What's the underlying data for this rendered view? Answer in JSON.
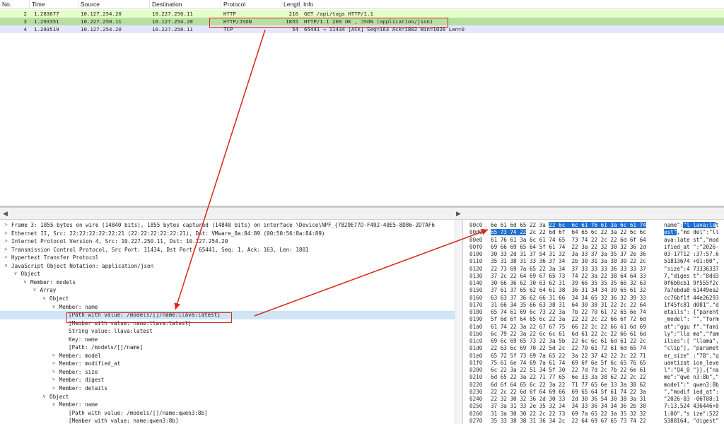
{
  "columns": [
    "No.",
    "Time",
    "Source",
    "Destination",
    "Protocol",
    "Lengtl",
    "Info"
  ],
  "packets": [
    {
      "no": "2",
      "time": "1.283677",
      "src": "10.127.254.20",
      "dst": "10.227.250.11",
      "proto": "HTTP",
      "len": "216",
      "info": "GET /api/tags HTTP/1.1"
    },
    {
      "no": "3",
      "time": "1.293351",
      "src": "10.227.250.11",
      "dst": "10.127.254.20",
      "proto": "HTTP/JSON",
      "len": "1855",
      "info": "HTTP/1.1 200 OK , JSON (application/json)"
    },
    {
      "no": "4",
      "time": "1.293519",
      "src": "10.127.254.20",
      "dst": "10.227.250.11",
      "proto": "TCP",
      "len": "54",
      "info": "65441 → 11434 [ACK] Seq=163 Ack=1802 Win=1026 Len=0"
    }
  ],
  "colors": {
    "row_http": "#e4ffc7",
    "row_selected": "#b7dfa1",
    "row_tcp": "#e7e6ff",
    "tree_selected": "#cfe4f7",
    "hex_highlight": "#1e6fd0",
    "annotation_red": "#d9261c"
  },
  "icons": {
    "expanded": "chevron-down-icon",
    "collapsed": "chevron-right-icon"
  },
  "tree": [
    {
      "level": 0,
      "arrow": ">",
      "text": "Frame 3: 1855 bytes on wire (14840 bits), 1855 bytes captured (14840 bits) on interface \\Device\\NPF_{7829E77D-F492-40E5-8D86-2D7AF6"
    },
    {
      "level": 0,
      "arrow": ">",
      "text": "Ethernet II, Src: 22:22:22:22:22:21 (22:22:22:22:22:21), Dst: VMware_8a:84:89 (00:50:56:8a:84:89)"
    },
    {
      "level": 0,
      "arrow": ">",
      "text": "Internet Protocol Version 4, Src: 10.227.250.11, Dst: 10.127.254.20"
    },
    {
      "level": 0,
      "arrow": ">",
      "text": "Transmission Control Protocol, Src Port: 11434, Dst Port: 65441, Seq: 1, Ack: 163, Len: 1801"
    },
    {
      "level": 0,
      "arrow": ">",
      "text": "Hypertext Transfer Protocol"
    },
    {
      "level": 0,
      "arrow": "v",
      "text": "JavaScript Object Notation: application/json"
    },
    {
      "level": 1,
      "arrow": "v",
      "text": "Object"
    },
    {
      "level": 2,
      "arrow": "v",
      "text": "Member: models"
    },
    {
      "level": 3,
      "arrow": "v",
      "text": "Array"
    },
    {
      "level": 4,
      "arrow": "v",
      "text": "Object"
    },
    {
      "level": 5,
      "arrow": "v",
      "text": "Member: name"
    },
    {
      "level": 6,
      "arrow": "",
      "text": "[Path with value: /models/[]/name:llava:latest]",
      "selected": true
    },
    {
      "level": 6,
      "arrow": "",
      "text": "[Member with value: name:llava:latest]"
    },
    {
      "level": 6,
      "arrow": "",
      "text": "String value: llava:latest"
    },
    {
      "level": 6,
      "arrow": "",
      "text": "Key: name"
    },
    {
      "level": 6,
      "arrow": "",
      "text": "[Path: /models/[]/name]"
    },
    {
      "level": 5,
      "arrow": ">",
      "text": "Member: model"
    },
    {
      "level": 5,
      "arrow": ">",
      "text": "Member: modified_at"
    },
    {
      "level": 5,
      "arrow": ">",
      "text": "Member: size"
    },
    {
      "level": 5,
      "arrow": ">",
      "text": "Member: digest"
    },
    {
      "level": 5,
      "arrow": ">",
      "text": "Member: details"
    },
    {
      "level": 4,
      "arrow": "v",
      "text": "Object"
    },
    {
      "level": 5,
      "arrow": "v",
      "text": "Member: name"
    },
    {
      "level": 6,
      "arrow": "",
      "text": "[Path with value: /models/[]/name:qwen3:8b]"
    },
    {
      "level": 6,
      "arrow": "",
      "text": "[Member with value: name:qwen3:8b]"
    }
  ],
  "hex": [
    {
      "off": "00c0",
      "bytes": [
        "6e",
        "61",
        "6d",
        "65",
        "22",
        "3a",
        "22",
        "6c",
        "6c",
        "61",
        "76",
        "61",
        "3a",
        "6c",
        "61",
        "74"
      ],
      "ascii": "name\":\"l lava:lat",
      "hl_bytes": [
        6,
        15
      ],
      "hl_ascii": [
        6,
        16
      ]
    },
    {
      "off": "00d0",
      "bytes": [
        "65",
        "73",
        "74",
        "22",
        "2c",
        "22",
        "6d",
        "6f",
        "64",
        "65",
        "6c",
        "22",
        "3a",
        "22",
        "6c",
        "6c"
      ],
      "ascii": "est\",\"mo del\":\"ll",
      "hl_bytes": [
        0,
        3
      ],
      "hl_ascii": [
        0,
        4
      ]
    },
    {
      "off": "00e0",
      "bytes": [
        "61",
        "76",
        "61",
        "3a",
        "6c",
        "61",
        "74",
        "65",
        "73",
        "74",
        "22",
        "2c",
        "22",
        "6d",
        "6f",
        "64"
      ],
      "ascii": "ava:late st\",\"mod"
    },
    {
      "off": "00f0",
      "bytes": [
        "69",
        "66",
        "69",
        "65",
        "64",
        "5f",
        "61",
        "74",
        "22",
        "3a",
        "22",
        "32",
        "30",
        "32",
        "36",
        "2d"
      ],
      "ascii": "ified_at \":\"2026-"
    },
    {
      "off": "0100",
      "bytes": [
        "30",
        "33",
        "2d",
        "31",
        "37",
        "54",
        "31",
        "32",
        "3a",
        "33",
        "37",
        "3a",
        "35",
        "37",
        "2e",
        "36"
      ],
      "ascii": "03-17T12 :37:57.6"
    },
    {
      "off": "0110",
      "bytes": [
        "35",
        "31",
        "38",
        "31",
        "33",
        "36",
        "37",
        "34",
        "2b",
        "30",
        "31",
        "3a",
        "30",
        "30",
        "22",
        "2c"
      ],
      "ascii": "51813674 +01:00\","
    },
    {
      "off": "0120",
      "bytes": [
        "22",
        "73",
        "69",
        "7a",
        "65",
        "22",
        "3a",
        "34",
        "37",
        "33",
        "33",
        "33",
        "36",
        "33",
        "33",
        "37"
      ],
      "ascii": "\"size\":4 73336337"
    },
    {
      "off": "0130",
      "bytes": [
        "37",
        "2c",
        "22",
        "64",
        "69",
        "67",
        "65",
        "73",
        "74",
        "22",
        "3a",
        "22",
        "38",
        "64",
        "64",
        "33"
      ],
      "ascii": "7,\"diges t\":\"8dd3"
    },
    {
      "off": "0140",
      "bytes": [
        "30",
        "66",
        "36",
        "62",
        "30",
        "63",
        "62",
        "31",
        "39",
        "66",
        "35",
        "35",
        "35",
        "66",
        "32",
        "63"
      ],
      "ascii": "0f6b0cb1 9f555f2c"
    },
    {
      "off": "0150",
      "bytes": [
        "37",
        "61",
        "37",
        "65",
        "62",
        "64",
        "61",
        "38",
        "36",
        "31",
        "34",
        "34",
        "39",
        "65",
        "61",
        "32"
      ],
      "ascii": "7a7ebda8 61449ea2"
    },
    {
      "off": "0160",
      "bytes": [
        "63",
        "63",
        "37",
        "36",
        "62",
        "66",
        "31",
        "66",
        "34",
        "34",
        "65",
        "32",
        "36",
        "32",
        "39",
        "33"
      ],
      "ascii": "cc76bf1f 44e26293"
    },
    {
      "off": "0170",
      "bytes": [
        "31",
        "66",
        "34",
        "35",
        "66",
        "63",
        "38",
        "31",
        "64",
        "30",
        "38",
        "31",
        "22",
        "2c",
        "22",
        "64"
      ],
      "ascii": "1f45fc81 d081\",\"d"
    },
    {
      "off": "0180",
      "bytes": [
        "65",
        "74",
        "61",
        "69",
        "6c",
        "73",
        "22",
        "3a",
        "7b",
        "22",
        "70",
        "61",
        "72",
        "65",
        "6e",
        "74"
      ],
      "ascii": "etails\": {\"parent"
    },
    {
      "off": "0190",
      "bytes": [
        "5f",
        "6d",
        "6f",
        "64",
        "65",
        "6c",
        "22",
        "3a",
        "22",
        "22",
        "2c",
        "22",
        "66",
        "6f",
        "72",
        "6d"
      ],
      "ascii": "_model\": \"\",\"form"
    },
    {
      "off": "01a0",
      "bytes": [
        "61",
        "74",
        "22",
        "3a",
        "22",
        "67",
        "67",
        "75",
        "66",
        "22",
        "2c",
        "22",
        "66",
        "61",
        "6d",
        "69"
      ],
      "ascii": "at\":\"ggu f\",\"fami"
    },
    {
      "off": "01b0",
      "bytes": [
        "6c",
        "79",
        "22",
        "3a",
        "22",
        "6c",
        "6c",
        "61",
        "6d",
        "61",
        "22",
        "2c",
        "22",
        "66",
        "61",
        "6d"
      ],
      "ascii": "ly\":\"lla ma\",\"fam"
    },
    {
      "off": "01c0",
      "bytes": [
        "69",
        "6c",
        "69",
        "65",
        "73",
        "22",
        "3a",
        "5b",
        "22",
        "6c",
        "6c",
        "61",
        "6d",
        "61",
        "22",
        "2c"
      ],
      "ascii": "ilies\":[ \"llama\","
    },
    {
      "off": "01d0",
      "bytes": [
        "22",
        "63",
        "6c",
        "69",
        "70",
        "22",
        "5d",
        "2c",
        "22",
        "70",
        "61",
        "72",
        "61",
        "6d",
        "65",
        "74"
      ],
      "ascii": "\"clip\"], \"paramet"
    },
    {
      "off": "01e0",
      "bytes": [
        "65",
        "72",
        "5f",
        "73",
        "69",
        "7a",
        "65",
        "22",
        "3a",
        "22",
        "37",
        "42",
        "22",
        "2c",
        "22",
        "71"
      ],
      "ascii": "er_size\" :\"7B\",\"q"
    },
    {
      "off": "01f0",
      "bytes": [
        "75",
        "61",
        "6e",
        "74",
        "69",
        "7a",
        "61",
        "74",
        "69",
        "6f",
        "6e",
        "5f",
        "6c",
        "65",
        "76",
        "65"
      ],
      "ascii": "uantizat ion_leve"
    },
    {
      "off": "0200",
      "bytes": [
        "6c",
        "22",
        "3a",
        "22",
        "51",
        "34",
        "5f",
        "30",
        "22",
        "7d",
        "7d",
        "2c",
        "7b",
        "22",
        "6e",
        "61"
      ],
      "ascii": "l\":\"Q4_0 \"}},{\"na"
    },
    {
      "off": "0210",
      "bytes": [
        "6d",
        "65",
        "22",
        "3a",
        "22",
        "71",
        "77",
        "65",
        "6e",
        "33",
        "3a",
        "38",
        "62",
        "22",
        "2c",
        "22"
      ],
      "ascii": "me\":\"qwe n3:8b\",\""
    },
    {
      "off": "0220",
      "bytes": [
        "6d",
        "6f",
        "64",
        "65",
        "6c",
        "22",
        "3a",
        "22",
        "71",
        "77",
        "65",
        "6e",
        "33",
        "3a",
        "38",
        "62"
      ],
      "ascii": "model\":\" qwen3:8b"
    },
    {
      "off": "0230",
      "bytes": [
        "22",
        "2c",
        "22",
        "6d",
        "6f",
        "64",
        "69",
        "66",
        "69",
        "65",
        "64",
        "5f",
        "61",
        "74",
        "22",
        "3a"
      ],
      "ascii": "\",\"modif ied_at\":"
    },
    {
      "off": "0240",
      "bytes": [
        "22",
        "32",
        "30",
        "32",
        "36",
        "2d",
        "30",
        "33",
        "2d",
        "30",
        "36",
        "54",
        "30",
        "38",
        "3a",
        "31"
      ],
      "ascii": "\"2026-03 -06T08:1"
    },
    {
      "off": "0250",
      "bytes": [
        "37",
        "3a",
        "31",
        "33",
        "2e",
        "35",
        "32",
        "34",
        "34",
        "33",
        "36",
        "34",
        "34",
        "36",
        "2b",
        "30"
      ],
      "ascii": "7:13.524 436446+0"
    },
    {
      "off": "0260",
      "bytes": [
        "31",
        "3a",
        "30",
        "30",
        "22",
        "2c",
        "22",
        "73",
        "69",
        "7a",
        "65",
        "22",
        "3a",
        "35",
        "32",
        "32"
      ],
      "ascii": "1:00\",\"s ize\":522"
    },
    {
      "off": "0270",
      "bytes": [
        "35",
        "33",
        "38",
        "38",
        "31",
        "36",
        "34",
        "2c",
        "22",
        "64",
        "69",
        "67",
        "65",
        "73",
        "74",
        "22"
      ],
      "ascii": "5388164, \"digest\""
    }
  ]
}
